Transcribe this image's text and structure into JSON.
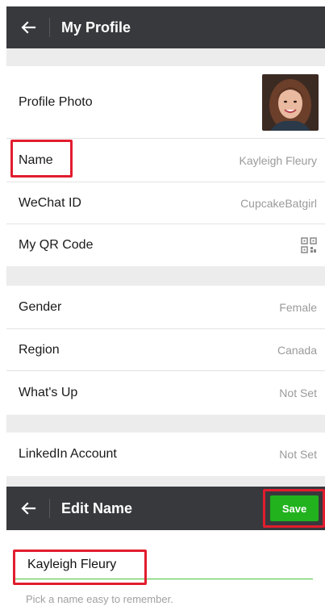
{
  "header": {
    "title": "My Profile",
    "back_icon": "arrow-left-icon"
  },
  "profile": {
    "photo_label": "Profile Photo",
    "name_label": "Name",
    "name_value": "Kayleigh Fleury",
    "wechat_label": "WeChat ID",
    "wechat_value": "CupcakeBatgirl",
    "qr_label": "My QR Code",
    "qr_icon": "qr-code-icon",
    "gender_label": "Gender",
    "gender_value": "Female",
    "region_label": "Region",
    "region_value": "Canada",
    "whatsup_label": "What's Up",
    "whatsup_value": "Not Set",
    "linkedin_label": "LinkedIn Account",
    "linkedin_value": "Not Set"
  },
  "edit": {
    "title": "Edit Name",
    "save_label": "Save",
    "name_value": "Kayleigh Fleury",
    "hint": "Pick a name easy to remember."
  },
  "colors": {
    "bar": "#38393d",
    "highlight": "#e11d2e",
    "save": "#21b21e",
    "underline": "#4bc13f"
  }
}
